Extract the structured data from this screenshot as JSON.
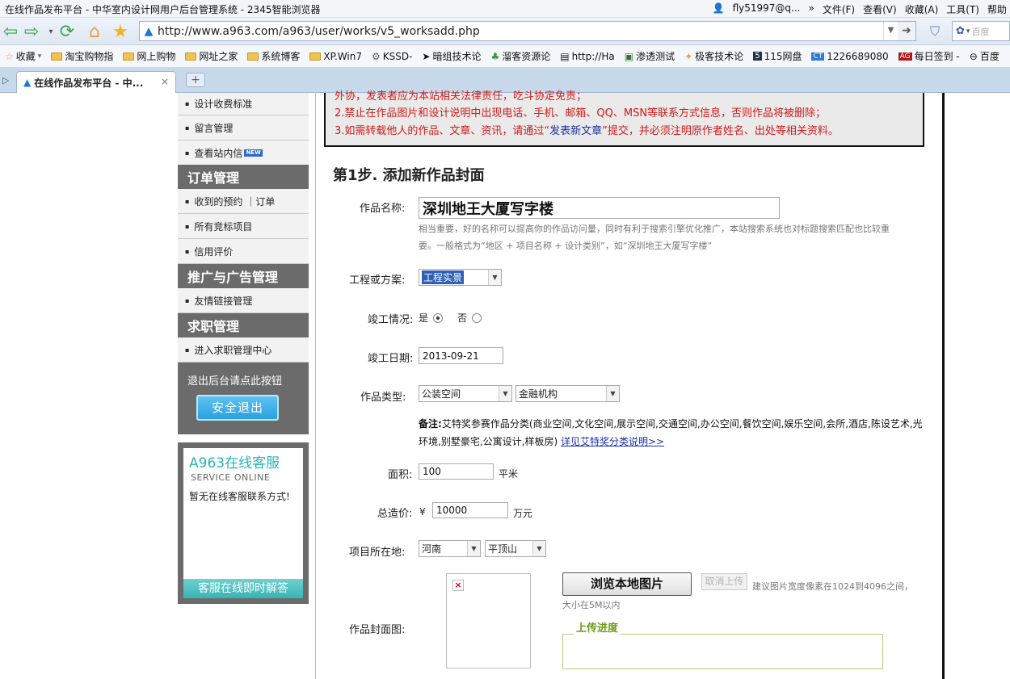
{
  "browser": {
    "window_title": "在线作品发布平台 - 中华室内设计网用户后台管理系统 - 2345智能浏览器",
    "user": "fly51997@q...",
    "menu": [
      "文件(F)",
      "查看(V)",
      "收藏(A)",
      "工具(T)",
      "帮助"
    ],
    "url": "http://www.a963.com/a963/user/works/v5_worksadd.php",
    "search_placeholder": "百度",
    "bookmarks": [
      "收藏",
      "淘宝购物指",
      "网上购物",
      "网址之家",
      "系统博客",
      "XP.Win7",
      "KSSD-",
      "暗组技术论",
      "溜客资源论",
      "http://Ha",
      "渗透测试",
      "极客技术论",
      "115网盘",
      "1226689080",
      "每日签到 -",
      "百度"
    ],
    "tab_title": "在线作品发布平台 - 中...",
    "tab_close": "×",
    "new_tab": "+"
  },
  "sidebar": {
    "items_top": [
      "设计收费标准",
      "留言管理",
      "查看站内信"
    ],
    "new_badge": "NEW",
    "sections": [
      {
        "title": "订单管理",
        "items": [
          "收到的预约 ｜订单",
          "所有竞标项目",
          "信用评价"
        ]
      },
      {
        "title": "推广与广告管理",
        "items": [
          "友情链接管理"
        ]
      },
      {
        "title": "求职管理",
        "items": [
          "进入求职管理中心"
        ]
      }
    ],
    "logout_hint": "退出后台请点此按钮",
    "logout_button": "安全退出",
    "service_title": "A963在线客服",
    "service_sub": "SERVICE ONLINE",
    "service_none": "暂无在线客服联系方式!",
    "service_bar": "客服在线即时解答"
  },
  "notice": {
    "line1_partial": "外协，发表者应为本站相关法律责任，吃斗协定免责；",
    "line2": "2.禁止在作品图片和设计说明中出现电话、手机、邮箱、QQ、MSN等联系方式信息，否则作品将被删除；",
    "line3_a": "3.如需转载他人的作品、文章、资讯，请通过“",
    "line3_link": "发表新文章",
    "line3_b": "”提交，并必须注明原作者姓名、出处等相关资料。"
  },
  "form": {
    "step_title": "第1步. 添加新作品封面",
    "name_label": "作品名称:",
    "name_value": "深圳地王大厦写字楼",
    "name_hint1": "相当重要，好的名称可以提高你的作品访问量，同时有利于搜索引擎优化推广，本站搜索系统也对标题搜索匹配也比较重",
    "name_hint2": "要。一般格式为“地区 + 项目名称 + 设计类别”，如“深圳地王大厦写字楼”",
    "type_label": "工程或方案:",
    "type_value": "工程实景",
    "completed_label": "竣工情况:",
    "yes": "是",
    "no": "否",
    "completed_selected": "是",
    "date_label": "竣工日期:",
    "date_value": "2013-09-21",
    "category_label": "作品类型:",
    "category_value": "公装空间",
    "subcategory_value": "金融机构",
    "remark_bold": "备注:",
    "remark_text": "艾特奖参赛作品分类(商业空间,文化空间,展示空间,交通空间,办公空间,餐饮空间,娱乐空间,会所,酒店,陈设艺术,光",
    "remark_text2": "环境,别墅豪宅,公寓设计,样板房)",
    "remark_link": "详见艾特奖分类说明>>",
    "area_label": "面积:",
    "area_value": "100",
    "area_unit": "平米",
    "cost_label": "总造价:",
    "currency": "¥",
    "cost_value": "10000",
    "cost_unit": "万元",
    "location_label": "项目所在地:",
    "province": "河南",
    "city": "平顶山",
    "cover_label": "作品封面图:",
    "browse_button": "浏览本地图片",
    "cancel_upload": "取消上传",
    "upload_hint1": "建议图片宽度像素在1024到4096之间，",
    "upload_hint2": "大小在5M以内",
    "progress_label": "上传进度"
  }
}
